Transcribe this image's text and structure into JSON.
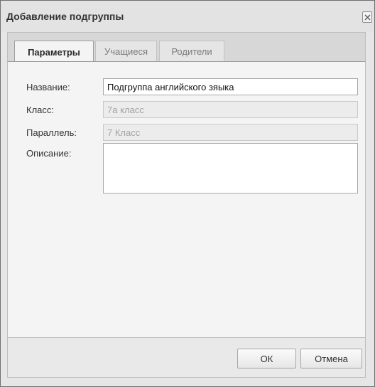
{
  "dialog": {
    "title": "Добавление подгруппы",
    "close_icon": "close-icon"
  },
  "tabs": [
    {
      "label": "Параметры",
      "active": true
    },
    {
      "label": "Учащиеся",
      "active": false
    },
    {
      "label": "Родители",
      "active": false
    }
  ],
  "form": {
    "name_label": "Название:",
    "name_value": "Подгруппа английского зяыка",
    "class_label": "Класс:",
    "class_value": "7а класс",
    "parallel_label": "Параллель:",
    "parallel_value": "7 Класс",
    "description_label": "Описание:",
    "description_value": ""
  },
  "buttons": {
    "ok": "ОК",
    "cancel": "Отмена"
  }
}
